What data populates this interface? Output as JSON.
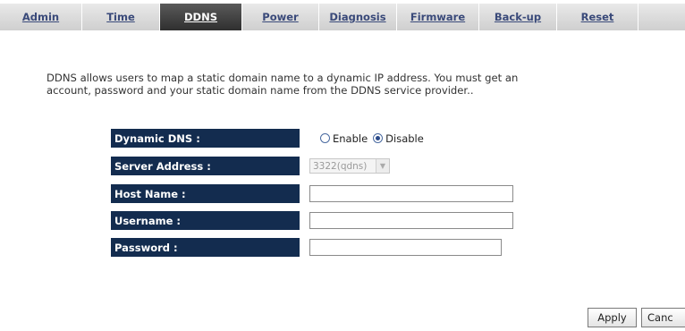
{
  "tabs": [
    {
      "label": "Admin",
      "active": false
    },
    {
      "label": "Time",
      "active": false
    },
    {
      "label": "DDNS",
      "active": true
    },
    {
      "label": "Power",
      "active": false
    },
    {
      "label": "Diagnosis",
      "active": false
    },
    {
      "label": "Firmware",
      "active": false
    },
    {
      "label": "Back-up",
      "active": false
    },
    {
      "label": "Reset",
      "active": false
    }
  ],
  "description": "DDNS allows users to map a static domain name to a dynamic IP address. You must get an\naccount, password and your static domain name from the DDNS service provider..",
  "form": {
    "dynamic_dns": {
      "label": "Dynamic DNS :",
      "option_enable": "Enable",
      "option_disable": "Disable",
      "selected": "Disable"
    },
    "server_address": {
      "label": "Server Address :",
      "value": "3322(qdns)"
    },
    "host_name": {
      "label": "Host Name :",
      "value": ""
    },
    "username": {
      "label": "Username :",
      "value": ""
    },
    "password": {
      "label": "Password :",
      "value": ""
    }
  },
  "buttons": {
    "apply": "Apply",
    "cancel": "Canc"
  },
  "colors": {
    "label_bg": "#132c4f",
    "active_tab_bg": "#3a3a3a",
    "tab_text": "#3a4a7a"
  }
}
